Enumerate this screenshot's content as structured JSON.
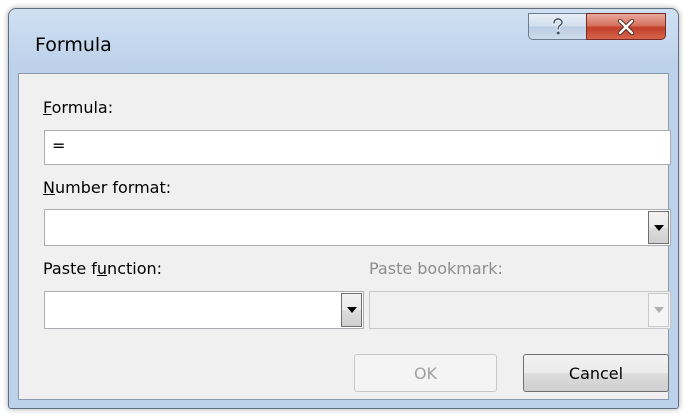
{
  "window": {
    "title": "Formula",
    "help_glyph": "?",
    "close_glyph": "X"
  },
  "formula": {
    "label_mnemonic": "F",
    "label_rest": "ormula:",
    "value": "="
  },
  "number_format": {
    "label_mnemonic": "N",
    "label_rest": "umber format:",
    "value": ""
  },
  "paste_function": {
    "label_pre": "Paste f",
    "label_mnemonic": "u",
    "label_post": "nction:",
    "value": ""
  },
  "paste_bookmark": {
    "label": "Paste bookmark:",
    "value": ""
  },
  "buttons": {
    "ok": "OK",
    "cancel": "Cancel"
  },
  "colors": {
    "close_button": "#c2402a",
    "titlebar": "#bcd1ea"
  }
}
